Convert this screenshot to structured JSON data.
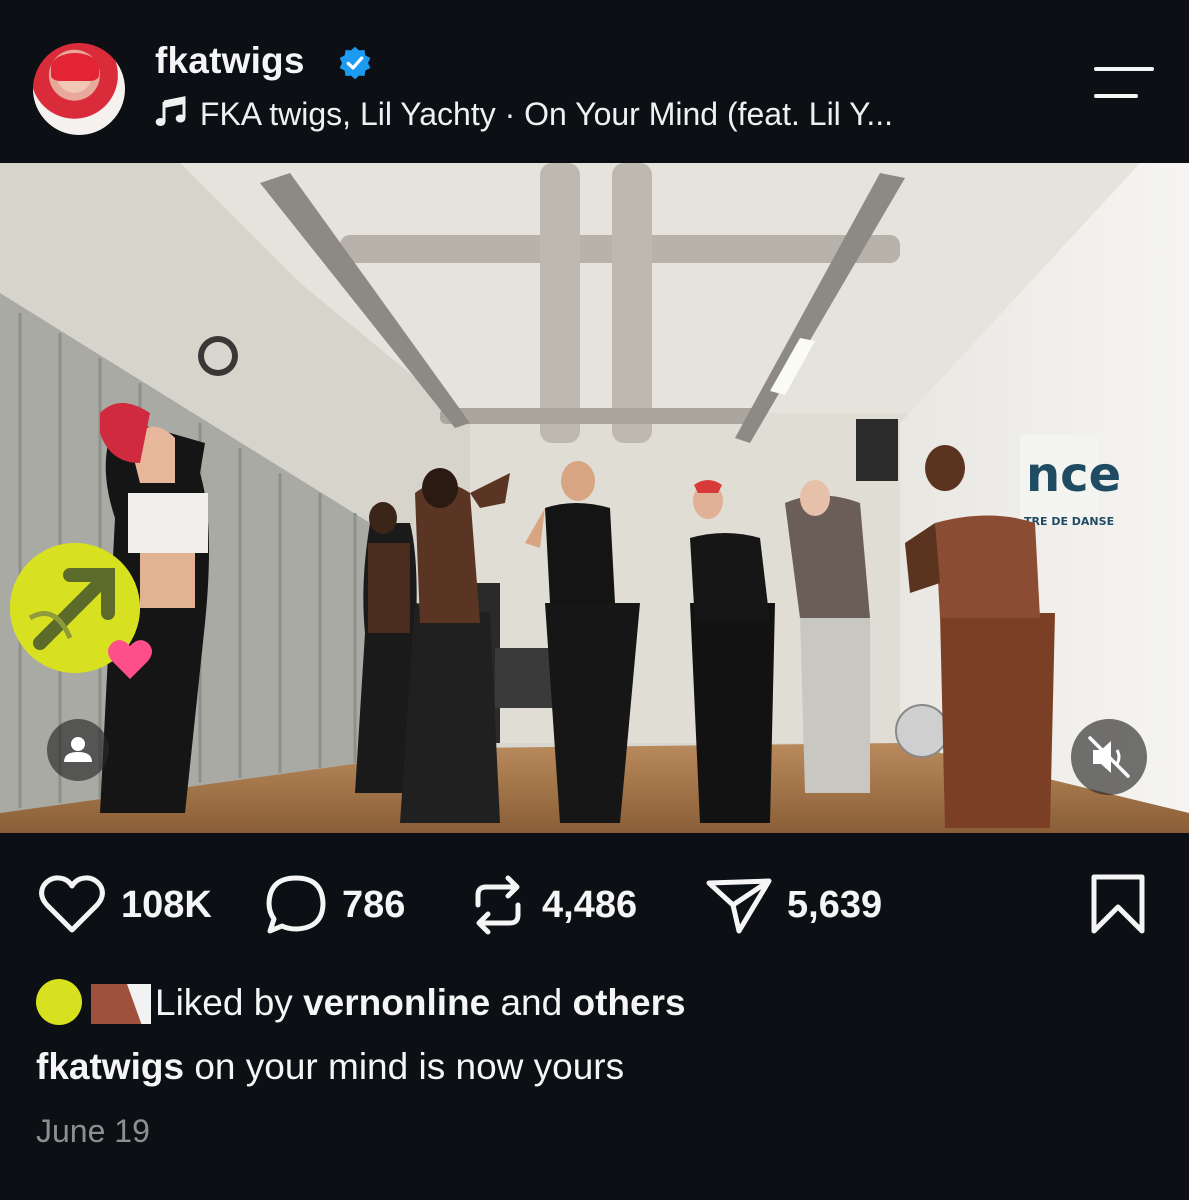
{
  "post": {
    "username": "fkatwigs",
    "audio": "FKA twigs, Lil Yachty · On Your Mind (feat. Lil Y...",
    "likes_count": "108K",
    "comments_count": "786",
    "reposts_count": "4,486",
    "shares_count": "5,639",
    "liked_by_prefix": "Liked by ",
    "liked_by_user": "vernonline",
    "liked_by_and": " and ",
    "liked_by_others": "others",
    "caption_user": "fkatwigs",
    "caption_text": " on your mind is now yours",
    "date": "June 19"
  },
  "media": {
    "wall_sign_text": "nce",
    "wall_sign_subtext": "TRE DE DANSE"
  },
  "colors": {
    "background": "#0c1014",
    "verified": "#1d9bf0",
    "secondary_text": "#8e8e8e"
  },
  "icons": [
    "verified-icon",
    "music-note-icon",
    "menu-icon",
    "heart-icon",
    "comment-icon",
    "repost-icon",
    "share-icon",
    "bookmark-icon",
    "user-tag-icon",
    "mute-icon"
  ]
}
